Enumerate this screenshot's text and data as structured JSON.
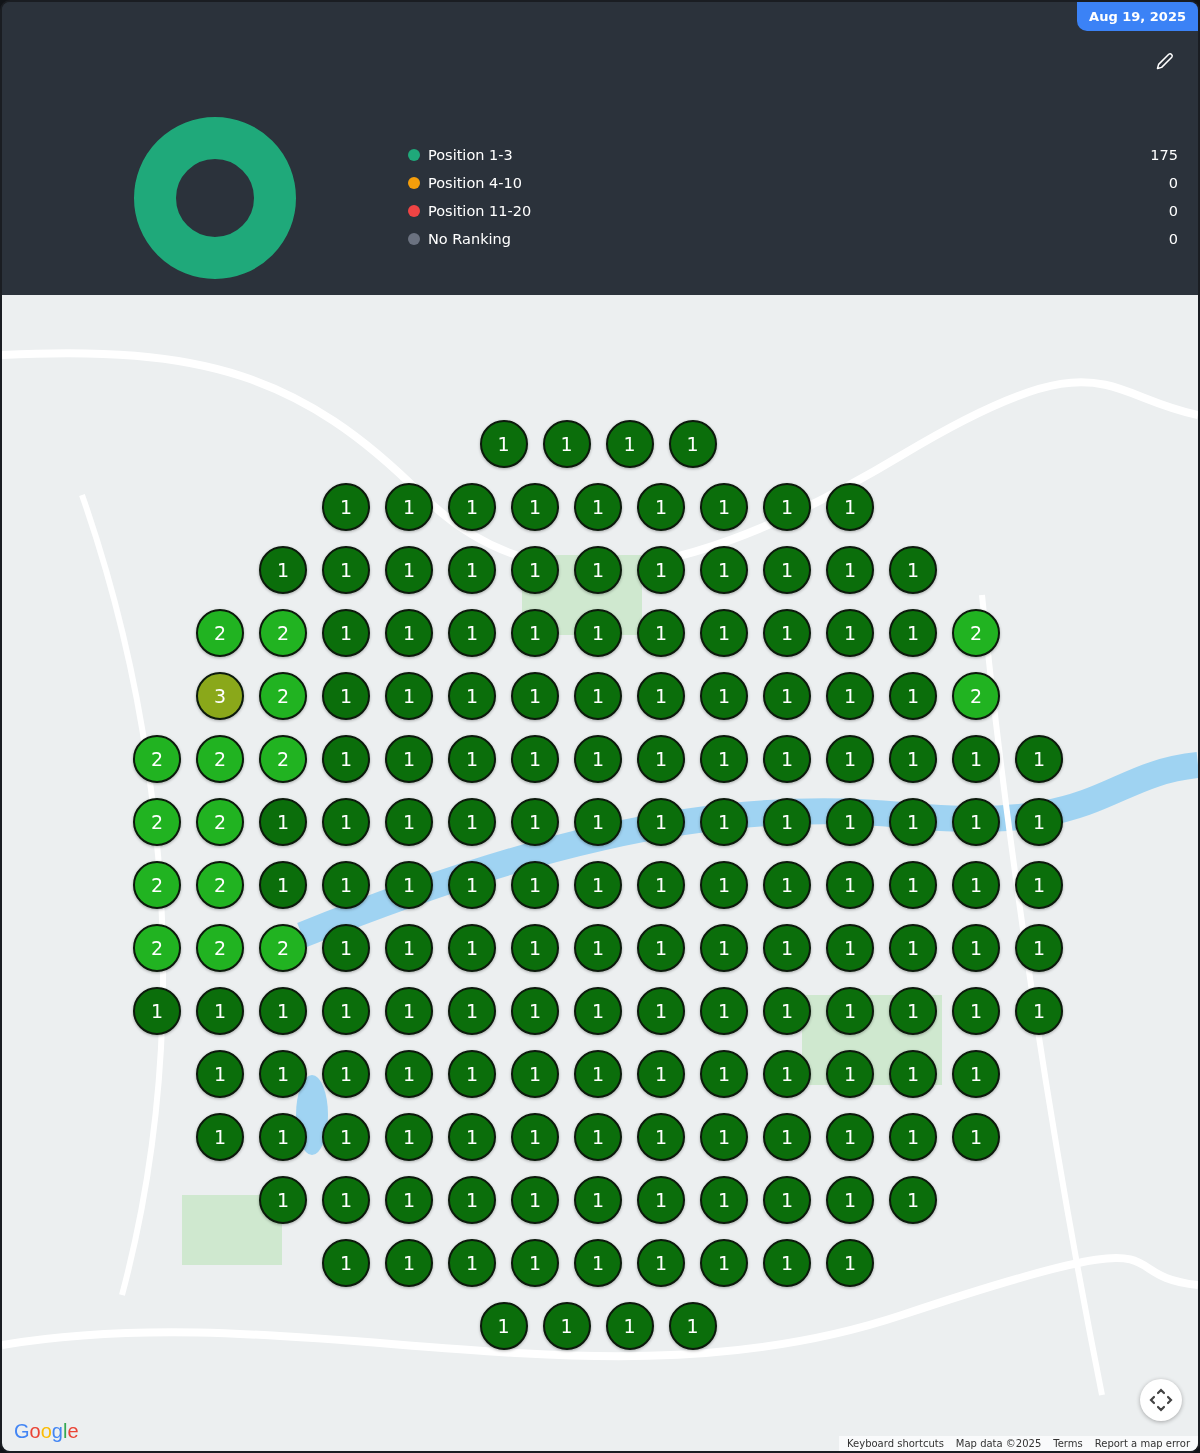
{
  "date_badge": "Aug 19, 2025",
  "summary": {
    "legend": [
      {
        "label": "Position 1-3",
        "count": "175",
        "color": "#1fa97a"
      },
      {
        "label": "Position 4-10",
        "count": "0",
        "color": "#f59e0b"
      },
      {
        "label": "Position 11-20",
        "count": "0",
        "color": "#ef4444"
      },
      {
        "label": "No Ranking",
        "count": "0",
        "color": "#6b7280"
      }
    ]
  },
  "map": {
    "rows": [
      [
        {
          "rank": "1",
          "color": "#0b6e0b"
        },
        {
          "rank": "1",
          "color": "#0b6e0b"
        },
        {
          "rank": "1",
          "color": "#0b6e0b"
        },
        {
          "rank": "1",
          "color": "#0b6e0b"
        }
      ],
      [
        {
          "rank": "1",
          "color": "#0b6e0b"
        },
        {
          "rank": "1",
          "color": "#0b6e0b"
        },
        {
          "rank": "1",
          "color": "#0b6e0b"
        },
        {
          "rank": "1",
          "color": "#0b6e0b"
        },
        {
          "rank": "1",
          "color": "#0b6e0b"
        },
        {
          "rank": "1",
          "color": "#0b6e0b"
        },
        {
          "rank": "1",
          "color": "#0b6e0b"
        },
        {
          "rank": "1",
          "color": "#0b6e0b"
        },
        {
          "rank": "1",
          "color": "#0b6e0b"
        }
      ],
      [
        {
          "rank": "1",
          "color": "#0b6e0b"
        },
        {
          "rank": "1",
          "color": "#0b6e0b"
        },
        {
          "rank": "1",
          "color": "#0b6e0b"
        },
        {
          "rank": "1",
          "color": "#0b6e0b"
        },
        {
          "rank": "1",
          "color": "#0b6e0b"
        },
        {
          "rank": "1",
          "color": "#0b6e0b"
        },
        {
          "rank": "1",
          "color": "#0b6e0b"
        },
        {
          "rank": "1",
          "color": "#0b6e0b"
        },
        {
          "rank": "1",
          "color": "#0b6e0b"
        },
        {
          "rank": "1",
          "color": "#0b6e0b"
        },
        {
          "rank": "1",
          "color": "#0b6e0b"
        }
      ],
      [
        {
          "rank": "2",
          "color": "#21b321"
        },
        {
          "rank": "2",
          "color": "#21b321"
        },
        {
          "rank": "1",
          "color": "#0b6e0b"
        },
        {
          "rank": "1",
          "color": "#0b6e0b"
        },
        {
          "rank": "1",
          "color": "#0b6e0b"
        },
        {
          "rank": "1",
          "color": "#0b6e0b"
        },
        {
          "rank": "1",
          "color": "#0b6e0b"
        },
        {
          "rank": "1",
          "color": "#0b6e0b"
        },
        {
          "rank": "1",
          "color": "#0b6e0b"
        },
        {
          "rank": "1",
          "color": "#0b6e0b"
        },
        {
          "rank": "1",
          "color": "#0b6e0b"
        },
        {
          "rank": "1",
          "color": "#0b6e0b"
        },
        {
          "rank": "2",
          "color": "#21b321"
        }
      ],
      [
        {
          "rank": "3",
          "color": "#8aa81a"
        },
        {
          "rank": "2",
          "color": "#21b321"
        },
        {
          "rank": "1",
          "color": "#0b6e0b"
        },
        {
          "rank": "1",
          "color": "#0b6e0b"
        },
        {
          "rank": "1",
          "color": "#0b6e0b"
        },
        {
          "rank": "1",
          "color": "#0b6e0b"
        },
        {
          "rank": "1",
          "color": "#0b6e0b"
        },
        {
          "rank": "1",
          "color": "#0b6e0b"
        },
        {
          "rank": "1",
          "color": "#0b6e0b"
        },
        {
          "rank": "1",
          "color": "#0b6e0b"
        },
        {
          "rank": "1",
          "color": "#0b6e0b"
        },
        {
          "rank": "1",
          "color": "#0b6e0b"
        },
        {
          "rank": "2",
          "color": "#21b321"
        }
      ],
      [
        {
          "rank": "2",
          "color": "#21b321"
        },
        {
          "rank": "2",
          "color": "#21b321"
        },
        {
          "rank": "2",
          "color": "#21b321"
        },
        {
          "rank": "1",
          "color": "#0b6e0b"
        },
        {
          "rank": "1",
          "color": "#0b6e0b"
        },
        {
          "rank": "1",
          "color": "#0b6e0b"
        },
        {
          "rank": "1",
          "color": "#0b6e0b"
        },
        {
          "rank": "1",
          "color": "#0b6e0b"
        },
        {
          "rank": "1",
          "color": "#0b6e0b"
        },
        {
          "rank": "1",
          "color": "#0b6e0b"
        },
        {
          "rank": "1",
          "color": "#0b6e0b"
        },
        {
          "rank": "1",
          "color": "#0b6e0b"
        },
        {
          "rank": "1",
          "color": "#0b6e0b"
        },
        {
          "rank": "1",
          "color": "#0b6e0b"
        },
        {
          "rank": "1",
          "color": "#0b6e0b"
        }
      ],
      [
        {
          "rank": "2",
          "color": "#21b321"
        },
        {
          "rank": "2",
          "color": "#21b321"
        },
        {
          "rank": "1",
          "color": "#0b6e0b"
        },
        {
          "rank": "1",
          "color": "#0b6e0b"
        },
        {
          "rank": "1",
          "color": "#0b6e0b"
        },
        {
          "rank": "1",
          "color": "#0b6e0b"
        },
        {
          "rank": "1",
          "color": "#0b6e0b"
        },
        {
          "rank": "1",
          "color": "#0b6e0b"
        },
        {
          "rank": "1",
          "color": "#0b6e0b"
        },
        {
          "rank": "1",
          "color": "#0b6e0b"
        },
        {
          "rank": "1",
          "color": "#0b6e0b"
        },
        {
          "rank": "1",
          "color": "#0b6e0b"
        },
        {
          "rank": "1",
          "color": "#0b6e0b"
        },
        {
          "rank": "1",
          "color": "#0b6e0b"
        },
        {
          "rank": "1",
          "color": "#0b6e0b"
        }
      ],
      [
        {
          "rank": "2",
          "color": "#21b321"
        },
        {
          "rank": "2",
          "color": "#21b321"
        },
        {
          "rank": "1",
          "color": "#0b6e0b"
        },
        {
          "rank": "1",
          "color": "#0b6e0b"
        },
        {
          "rank": "1",
          "color": "#0b6e0b"
        },
        {
          "rank": "1",
          "color": "#0b6e0b"
        },
        {
          "rank": "1",
          "color": "#0b6e0b"
        },
        {
          "rank": "1",
          "color": "#0b6e0b"
        },
        {
          "rank": "1",
          "color": "#0b6e0b"
        },
        {
          "rank": "1",
          "color": "#0b6e0b"
        },
        {
          "rank": "1",
          "color": "#0b6e0b"
        },
        {
          "rank": "1",
          "color": "#0b6e0b"
        },
        {
          "rank": "1",
          "color": "#0b6e0b"
        },
        {
          "rank": "1",
          "color": "#0b6e0b"
        },
        {
          "rank": "1",
          "color": "#0b6e0b"
        }
      ],
      [
        {
          "rank": "2",
          "color": "#21b321"
        },
        {
          "rank": "2",
          "color": "#21b321"
        },
        {
          "rank": "2",
          "color": "#21b321"
        },
        {
          "rank": "1",
          "color": "#0b6e0b"
        },
        {
          "rank": "1",
          "color": "#0b6e0b"
        },
        {
          "rank": "1",
          "color": "#0b6e0b"
        },
        {
          "rank": "1",
          "color": "#0b6e0b"
        },
        {
          "rank": "1",
          "color": "#0b6e0b"
        },
        {
          "rank": "1",
          "color": "#0b6e0b"
        },
        {
          "rank": "1",
          "color": "#0b6e0b"
        },
        {
          "rank": "1",
          "color": "#0b6e0b"
        },
        {
          "rank": "1",
          "color": "#0b6e0b"
        },
        {
          "rank": "1",
          "color": "#0b6e0b"
        },
        {
          "rank": "1",
          "color": "#0b6e0b"
        },
        {
          "rank": "1",
          "color": "#0b6e0b"
        }
      ],
      [
        {
          "rank": "1",
          "color": "#0b6e0b"
        },
        {
          "rank": "1",
          "color": "#0b6e0b"
        },
        {
          "rank": "1",
          "color": "#0b6e0b"
        },
        {
          "rank": "1",
          "color": "#0b6e0b"
        },
        {
          "rank": "1",
          "color": "#0b6e0b"
        },
        {
          "rank": "1",
          "color": "#0b6e0b"
        },
        {
          "rank": "1",
          "color": "#0b6e0b"
        },
        {
          "rank": "1",
          "color": "#0b6e0b"
        },
        {
          "rank": "1",
          "color": "#0b6e0b"
        },
        {
          "rank": "1",
          "color": "#0b6e0b"
        },
        {
          "rank": "1",
          "color": "#0b6e0b"
        },
        {
          "rank": "1",
          "color": "#0b6e0b"
        },
        {
          "rank": "1",
          "color": "#0b6e0b"
        },
        {
          "rank": "1",
          "color": "#0b6e0b"
        },
        {
          "rank": "1",
          "color": "#0b6e0b"
        }
      ],
      [
        {
          "rank": "1",
          "color": "#0b6e0b"
        },
        {
          "rank": "1",
          "color": "#0b6e0b"
        },
        {
          "rank": "1",
          "color": "#0b6e0b"
        },
        {
          "rank": "1",
          "color": "#0b6e0b"
        },
        {
          "rank": "1",
          "color": "#0b6e0b"
        },
        {
          "rank": "1",
          "color": "#0b6e0b"
        },
        {
          "rank": "1",
          "color": "#0b6e0b"
        },
        {
          "rank": "1",
          "color": "#0b6e0b"
        },
        {
          "rank": "1",
          "color": "#0b6e0b"
        },
        {
          "rank": "1",
          "color": "#0b6e0b"
        },
        {
          "rank": "1",
          "color": "#0b6e0b"
        },
        {
          "rank": "1",
          "color": "#0b6e0b"
        },
        {
          "rank": "1",
          "color": "#0b6e0b"
        }
      ],
      [
        {
          "rank": "1",
          "color": "#0b6e0b"
        },
        {
          "rank": "1",
          "color": "#0b6e0b"
        },
        {
          "rank": "1",
          "color": "#0b6e0b"
        },
        {
          "rank": "1",
          "color": "#0b6e0b"
        },
        {
          "rank": "1",
          "color": "#0b6e0b"
        },
        {
          "rank": "1",
          "color": "#0b6e0b"
        },
        {
          "rank": "1",
          "color": "#0b6e0b"
        },
        {
          "rank": "1",
          "color": "#0b6e0b"
        },
        {
          "rank": "1",
          "color": "#0b6e0b"
        },
        {
          "rank": "1",
          "color": "#0b6e0b"
        },
        {
          "rank": "1",
          "color": "#0b6e0b"
        },
        {
          "rank": "1",
          "color": "#0b6e0b"
        },
        {
          "rank": "1",
          "color": "#0b6e0b"
        }
      ],
      [
        {
          "rank": "1",
          "color": "#0b6e0b"
        },
        {
          "rank": "1",
          "color": "#0b6e0b"
        },
        {
          "rank": "1",
          "color": "#0b6e0b"
        },
        {
          "rank": "1",
          "color": "#0b6e0b"
        },
        {
          "rank": "1",
          "color": "#0b6e0b"
        },
        {
          "rank": "1",
          "color": "#0b6e0b"
        },
        {
          "rank": "1",
          "color": "#0b6e0b"
        },
        {
          "rank": "1",
          "color": "#0b6e0b"
        },
        {
          "rank": "1",
          "color": "#0b6e0b"
        },
        {
          "rank": "1",
          "color": "#0b6e0b"
        },
        {
          "rank": "1",
          "color": "#0b6e0b"
        }
      ],
      [
        {
          "rank": "1",
          "color": "#0b6e0b"
        },
        {
          "rank": "1",
          "color": "#0b6e0b"
        },
        {
          "rank": "1",
          "color": "#0b6e0b"
        },
        {
          "rank": "1",
          "color": "#0b6e0b"
        },
        {
          "rank": "1",
          "color": "#0b6e0b"
        },
        {
          "rank": "1",
          "color": "#0b6e0b"
        },
        {
          "rank": "1",
          "color": "#0b6e0b"
        },
        {
          "rank": "1",
          "color": "#0b6e0b"
        },
        {
          "rank": "1",
          "color": "#0b6e0b"
        }
      ],
      [
        {
          "rank": "1",
          "color": "#0b6e0b"
        },
        {
          "rank": "1",
          "color": "#0b6e0b"
        },
        {
          "rank": "1",
          "color": "#0b6e0b"
        },
        {
          "rank": "1",
          "color": "#0b6e0b"
        }
      ]
    ],
    "logo": "Google",
    "attribution": [
      "Keyboard shortcuts",
      "Map data ©2025",
      "Terms",
      "Report a map error"
    ]
  }
}
